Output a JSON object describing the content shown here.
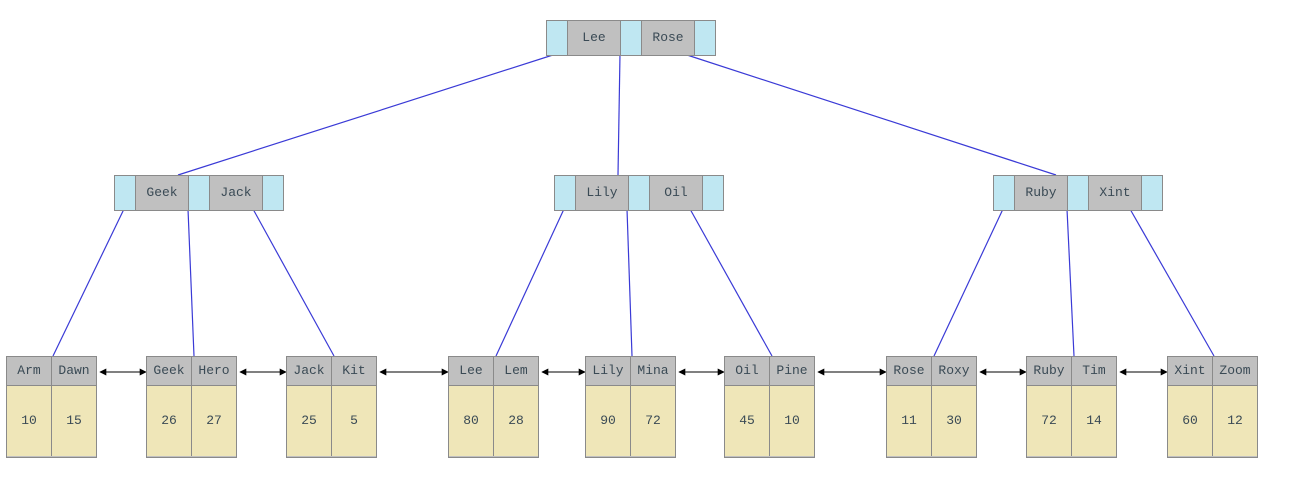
{
  "colors": {
    "pointer_bg": "#bfe7f2",
    "key_bg": "#c0c0c0",
    "leaf_value_bg": "#efe6b8",
    "edge": "#3a3ad6",
    "sibling_arrow": "#000000",
    "border": "#8a8a8a"
  },
  "tree": {
    "type": "b-plus-tree",
    "root": {
      "keys": [
        "Lee",
        "Rose"
      ]
    },
    "level1": [
      {
        "keys": [
          "Geek",
          "Jack"
        ]
      },
      {
        "keys": [
          "Lily",
          "Oil"
        ]
      },
      {
        "keys": [
          "Ruby",
          "Xint"
        ]
      }
    ],
    "leaves": [
      {
        "keys": [
          "Arm",
          "Dawn"
        ],
        "values": [
          10,
          15
        ]
      },
      {
        "keys": [
          "Geek",
          "Hero"
        ],
        "values": [
          26,
          27
        ]
      },
      {
        "keys": [
          "Jack",
          "Kit"
        ],
        "values": [
          25,
          5
        ]
      },
      {
        "keys": [
          "Lee",
          "Lem"
        ],
        "values": [
          80,
          28
        ]
      },
      {
        "keys": [
          "Lily",
          "Mina"
        ],
        "values": [
          90,
          72
        ]
      },
      {
        "keys": [
          "Oil",
          "Pine"
        ],
        "values": [
          45,
          10
        ]
      },
      {
        "keys": [
          "Rose",
          "Roxy"
        ],
        "values": [
          11,
          30
        ]
      },
      {
        "keys": [
          "Ruby",
          "Tim"
        ],
        "values": [
          72,
          14
        ]
      },
      {
        "keys": [
          "Xint",
          "Zoom"
        ],
        "values": [
          60,
          12
        ]
      }
    ]
  }
}
